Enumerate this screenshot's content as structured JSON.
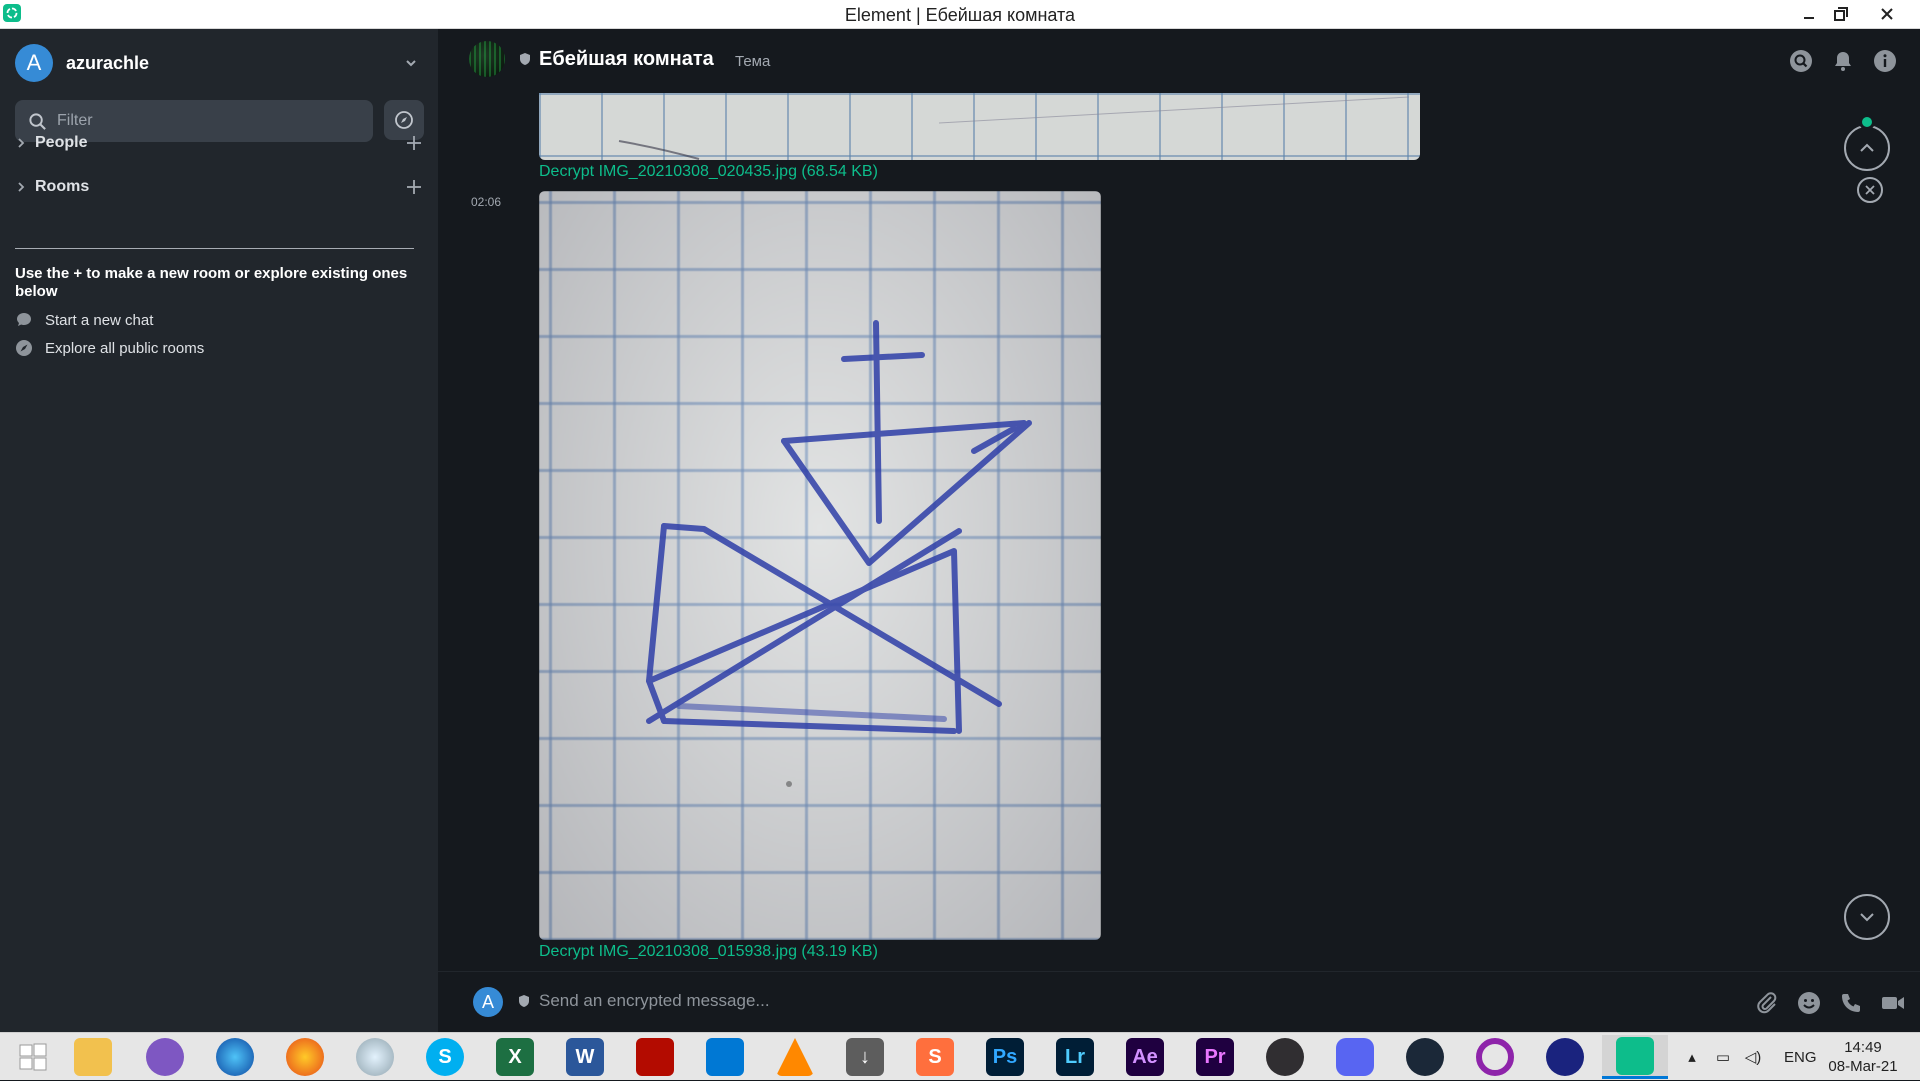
{
  "window": {
    "title": "Element | Ебейшая комната"
  },
  "sidebar": {
    "user": {
      "initial": "A",
      "name": "azurachle"
    },
    "filter_placeholder": "Filter",
    "sections": [
      {
        "label": "People"
      },
      {
        "label": "Rooms"
      }
    ],
    "hint": "Use the + to make a new room or explore existing ones below",
    "links": [
      {
        "label": "Start a new chat"
      },
      {
        "label": "Explore all public rooms"
      }
    ]
  },
  "room": {
    "name": "Ебейшая комната",
    "topic": "Тема"
  },
  "timeline": {
    "events": [
      {
        "attachment": "Decrypt IMG_20210308_020435.jpg (68.54 KB)"
      },
      {
        "timestamp": "02:06",
        "attachment": "Decrypt IMG_20210308_015938.jpg (43.19 KB)"
      }
    ]
  },
  "composer": {
    "initial": "A",
    "placeholder": "Send an encrypted message..."
  },
  "taskbar": {
    "apps": [
      "windows-start",
      "file-explorer",
      "tor-browser",
      "browser-globe",
      "firefox",
      "moon-app",
      "skype",
      "excel",
      "word",
      "acrobat",
      "vscode",
      "vlc",
      "downloader",
      "sublime-text",
      "photoshop",
      "lightroom",
      "after-effects",
      "premiere",
      "obs",
      "discord",
      "steam",
      "opera",
      "keepass",
      "element"
    ],
    "app_letters": {
      "photoshop": "Ps",
      "lightroom": "Lr",
      "after-effects": "Ae",
      "premiere": "Pr",
      "skype": "S"
    },
    "language": "ENG",
    "time": "14:49",
    "date": "08-Mar-21"
  },
  "colors": {
    "accent": "#0dbd8b",
    "avatar": "#368bd6",
    "sidebar_bg": "#21262c",
    "main_bg": "#15191e"
  }
}
